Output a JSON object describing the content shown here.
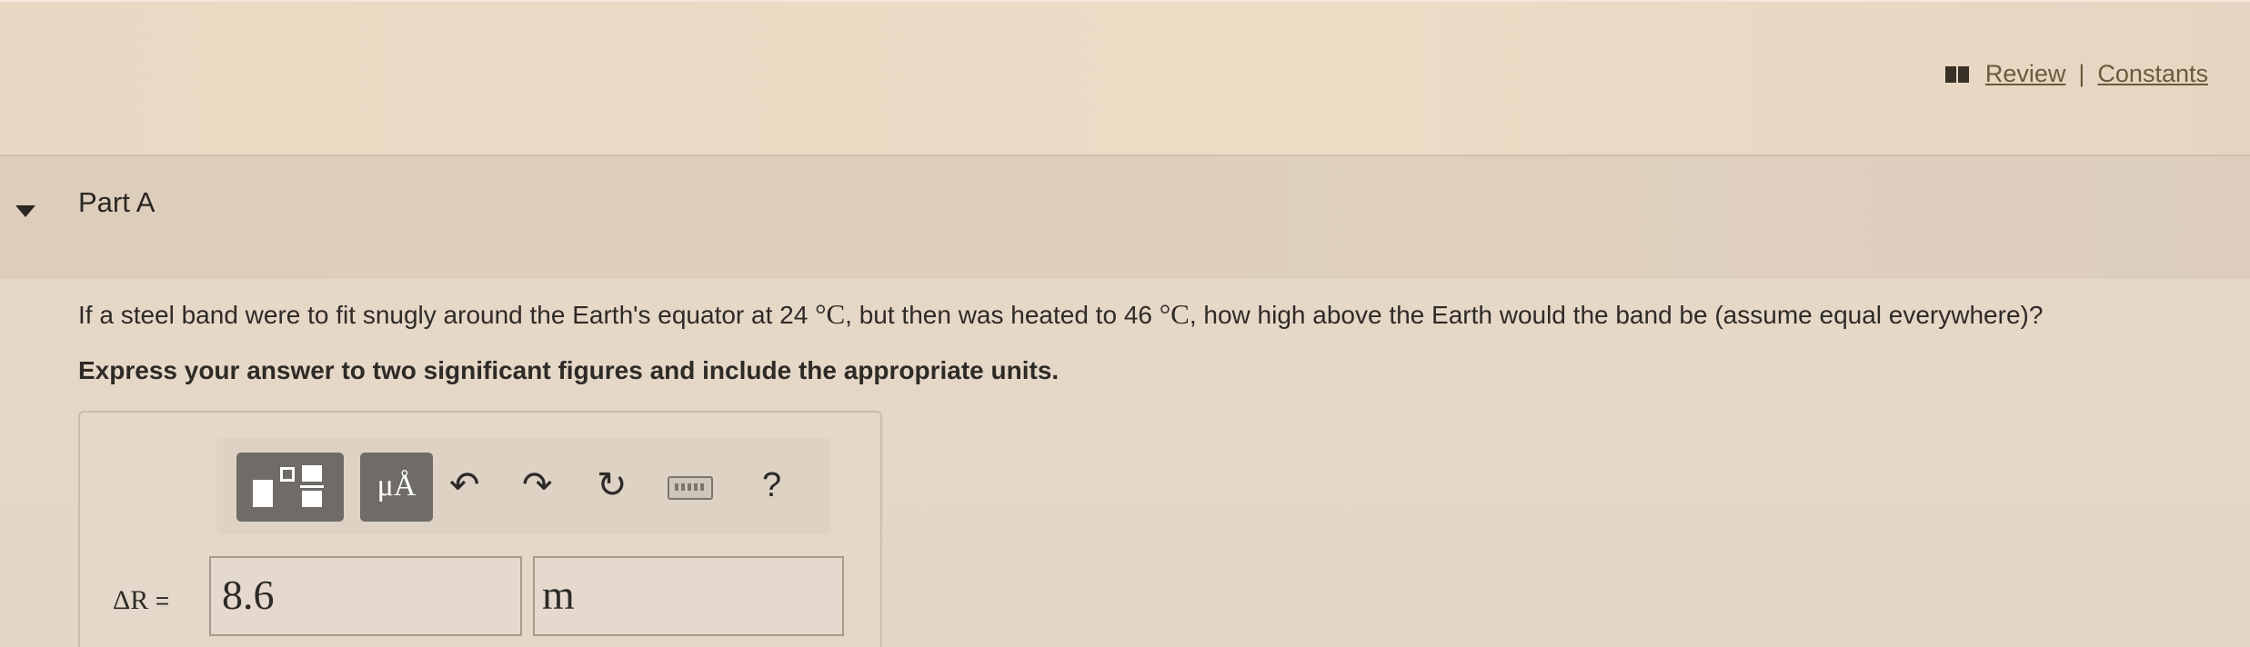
{
  "header": {
    "review_label": "Review",
    "separator": "|",
    "constants_label": "Constants"
  },
  "part": {
    "title": "Part A"
  },
  "question": {
    "text_before_t1": "If a steel band were to fit snugly around the Earth's equator at 24",
    "unit_1": "°C",
    "text_mid": ", but then was heated to 46",
    "unit_2": "°C",
    "text_after": ", how high above the Earth would the band be (assume equal everywhere)?",
    "instruction": "Express your answer to two significant figures and include the appropriate units."
  },
  "toolbar": {
    "units_button": "μÅ",
    "undo_icon": "↶",
    "redo_icon": "↷",
    "reset_icon": "↻",
    "help_label": "?"
  },
  "answer": {
    "label": "ΔR",
    "equals": "=",
    "value": "8.6",
    "unit": "m"
  }
}
